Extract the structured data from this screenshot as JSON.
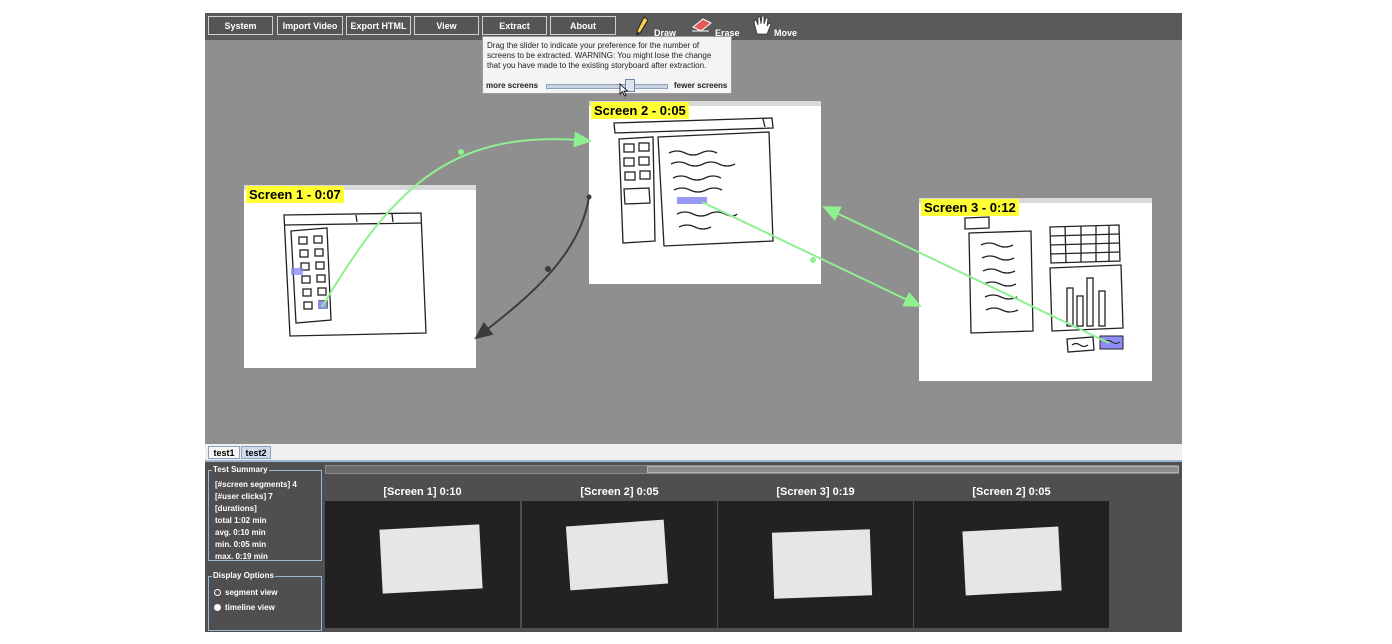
{
  "toolbar": {
    "buttons": [
      "System",
      "Import Video",
      "Export HTML",
      "View",
      "Extract",
      "About"
    ],
    "tools": {
      "draw": "Draw",
      "erase": "Erase",
      "move": "Move"
    }
  },
  "popup": {
    "message": "Drag the slider to indicate your preference for the number of screens to be extracted. WARNING: You might lose the change that you have made to the existing storyboard after extraction.",
    "left_label": "more screens",
    "right_label": "fewer screens",
    "slider_value_fraction": 0.62
  },
  "storyboard": {
    "screens": [
      {
        "title": "Screen 1 - 0:07"
      },
      {
        "title": "Screen 2 - 0:05"
      },
      {
        "title": "Screen 3 - 0:12"
      }
    ]
  },
  "tabs": [
    "test1",
    "test2"
  ],
  "summary": {
    "title": "Test Summary",
    "lines": [
      "[#screen segments]  4",
      "[#user clicks]  7",
      "[durations]",
      "total    1:02 min",
      "avg.     0:10 min",
      "min.    0:05 min",
      "max.   0:19 min"
    ]
  },
  "display_options": {
    "title": "Display Options",
    "options": [
      "segment view",
      "timeline view"
    ],
    "selected": "timeline view"
  },
  "segments": [
    {
      "label": "[Screen 1] 0:10"
    },
    {
      "label": "[Screen 2] 0:05"
    },
    {
      "label": "[Screen 3] 0:19"
    },
    {
      "label": "[Screen 2] 0:05"
    }
  ],
  "colors": {
    "flow_active": "#8ff08f",
    "flow_back": "#3c3c3c",
    "highlight": "#ffff33",
    "click_target": "#8d8df5"
  }
}
